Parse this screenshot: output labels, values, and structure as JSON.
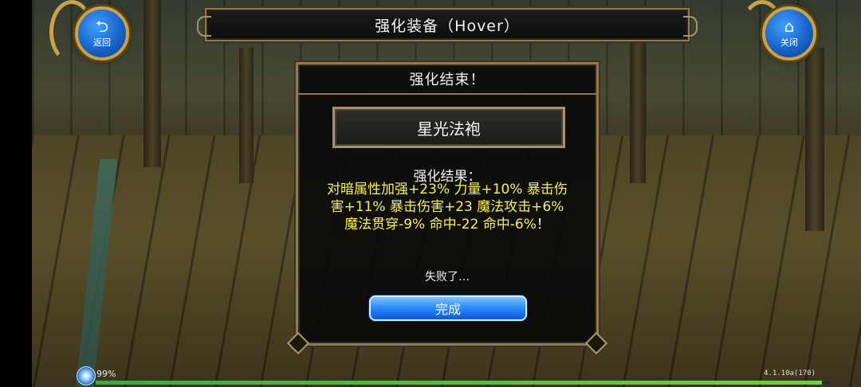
{
  "top_bar": {
    "title": "强化装备（Hover）",
    "back_label": "返回",
    "close_label": "关闭"
  },
  "dialog": {
    "header": "强化结束！",
    "item_name": "星光法袍",
    "result_label": "强化结果：",
    "result_lines": [
      "对暗属性加强+23% 力量+10% 暴击伤",
      "害+11% 暴击伤害+23 魔法攻击+6%",
      "魔法贯穿-9% 命中-22 命中-6%"
    ],
    "result_end_mark": "！",
    "status": "失败了…",
    "done_label": "完成"
  },
  "footer": {
    "percent": "99%",
    "progress_fraction": 0.99,
    "version": "4.1.10a(170)"
  },
  "colors": {
    "accent_blue": "#2f8cff",
    "result_yellow": "#f7f25a",
    "frame_gold": "#8c7b56"
  },
  "icons": {
    "back": "back-arrow-icon",
    "close": "home-icon",
    "loading": "loading-orb-icon"
  }
}
